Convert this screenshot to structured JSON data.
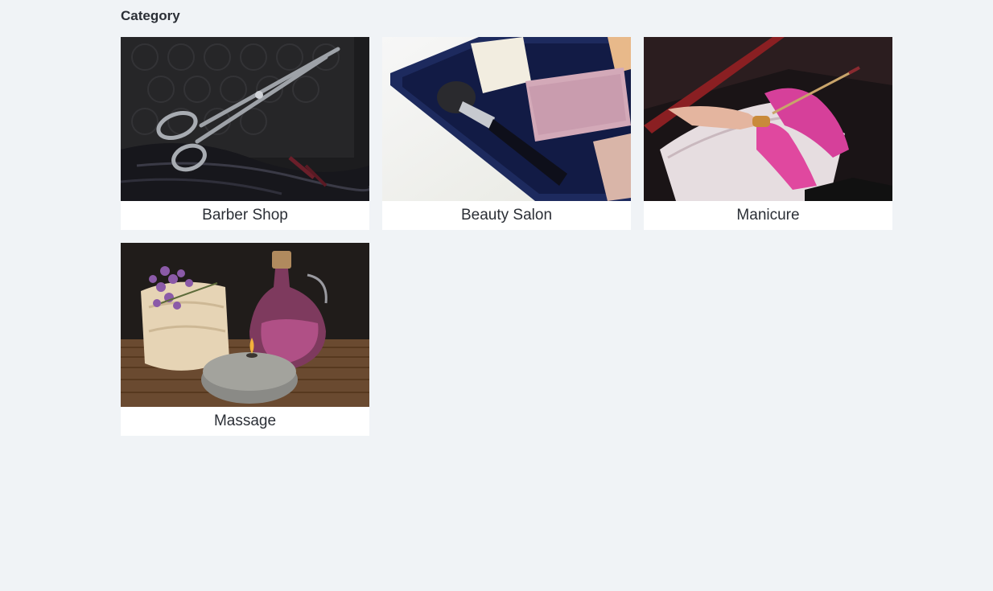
{
  "section": {
    "title": "Category"
  },
  "categories": [
    {
      "label": "Barber Shop",
      "image": "scissors-photo"
    },
    {
      "label": "Beauty Salon",
      "image": "eyeshadow-palette-photo"
    },
    {
      "label": "Manicure",
      "image": "manicure-photo"
    },
    {
      "label": "Massage",
      "image": "spa-massage-photo"
    }
  ],
  "colors": {
    "background": "#f0f3f6",
    "card": "#ffffff",
    "text": "#2b2f36"
  }
}
